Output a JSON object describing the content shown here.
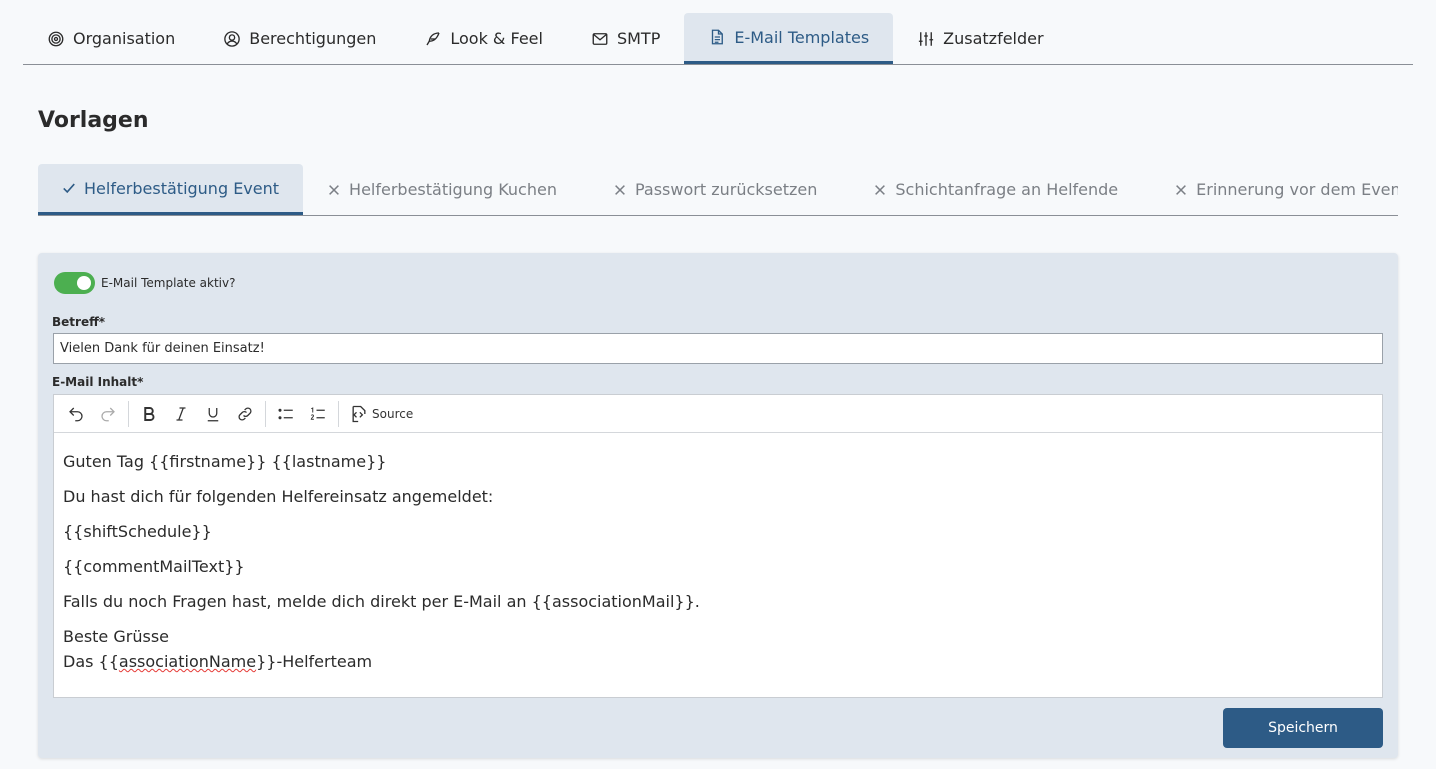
{
  "top_tabs": [
    {
      "label": "Organisation",
      "icon": "target-icon",
      "active": false
    },
    {
      "label": "Berechtigungen",
      "icon": "user-circle-icon",
      "active": false
    },
    {
      "label": "Look & Feel",
      "icon": "feather-icon",
      "active": false
    },
    {
      "label": "SMTP",
      "icon": "mail-icon",
      "active": false
    },
    {
      "label": "E-Mail Templates",
      "icon": "file-text-icon",
      "active": true
    },
    {
      "label": "Zusatzfelder",
      "icon": "sliders-icon",
      "active": false
    }
  ],
  "section_title": "Vorlagen",
  "template_tabs": [
    {
      "label": "Helferbestätigung Event",
      "status": "check",
      "active": true
    },
    {
      "label": "Helferbestätigung Kuchen",
      "status": "x",
      "active": false
    },
    {
      "label": "Passwort zurücksetzen",
      "status": "x",
      "active": false
    },
    {
      "label": "Schichtanfrage an Helfende",
      "status": "x",
      "active": false
    },
    {
      "label": "Erinnerung vor dem Event",
      "status": "x",
      "active": false
    }
  ],
  "form": {
    "toggle_label": "E-Mail Template aktiv?",
    "toggle_on": true,
    "subject_label": "Betreff*",
    "subject_value": "Vielen Dank für deinen Einsatz!",
    "content_label": "E-Mail Inhalt*",
    "toolbar": {
      "source_label": "Source"
    },
    "body": {
      "greeting": "Guten Tag {{firstname}} {{lastname}}",
      "line1": "Du hast dich für folgenden Helfereinsatz angemeldet:",
      "line2": "{{shiftSchedule}}",
      "line3": "{{commentMailText}}",
      "line4": "Falls du noch Fragen hast, melde dich direkt per E-Mail an {{associationMail}}.",
      "closing1": "Beste Grüsse",
      "closing2_prefix": "Das {{",
      "closing2_word": "associationName",
      "closing2_suffix": "}}-Helferteam"
    },
    "save_label": "Speichern"
  },
  "colors": {
    "accent": "#2d5b86",
    "active_tab_bg": "#dfe6ee",
    "toggle_on": "#4caf50"
  }
}
